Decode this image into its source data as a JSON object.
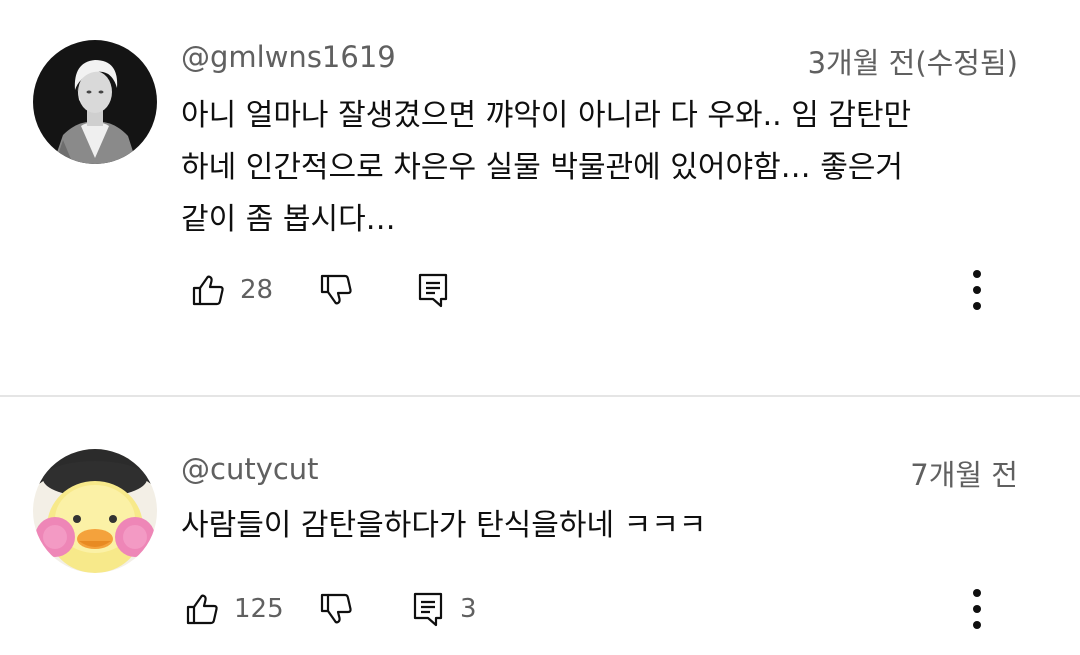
{
  "comments": [
    {
      "author": "@gmlwns1619",
      "time": "3개월 전(수정됨)",
      "lines": [
        "아니 얼마나 잘생겼으면 꺄악이 아니라 다 우와.. 임 감탄만",
        "하네 인간적으로 차은우 실물 박물관에 있어야함… 좋은거",
        "같이 좀 봅시다…"
      ],
      "likes": "28",
      "replies": "",
      "avatar_icon": "person-photo-avatar-icon"
    },
    {
      "author": "@cutycut",
      "time": "7개월 전",
      "lines": [
        "사람들이 감탄을하다가 탄식을하네 ㅋㅋㅋ"
      ],
      "likes": "125",
      "replies": "3",
      "avatar_icon": "duck-plush-avatar-icon"
    }
  ],
  "icons": {
    "like": "thumbs-up-icon",
    "dislike": "thumbs-down-icon",
    "reply": "reply-comment-icon",
    "more": "more-vertical-icon"
  },
  "colors": {
    "text_primary": "#0f0f0f",
    "text_secondary": "#606060",
    "divider": "#e5e5e5"
  }
}
